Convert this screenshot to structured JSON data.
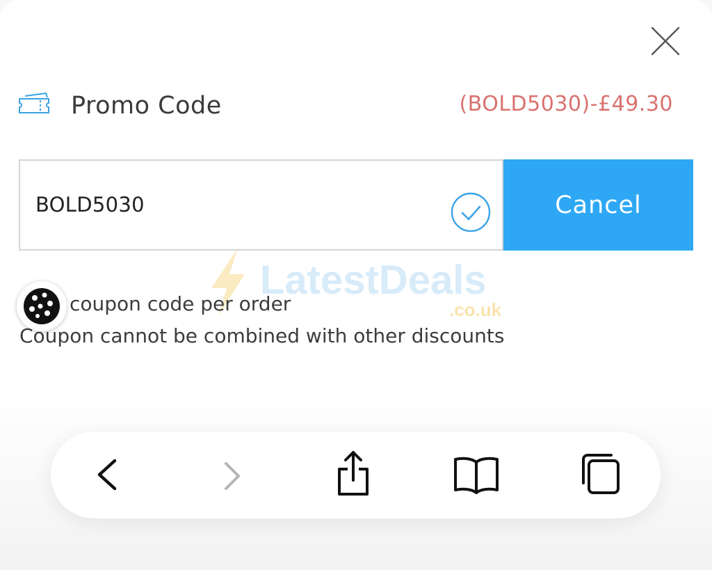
{
  "promo": {
    "title": "Promo Code",
    "applied_summary": "(BOLD5030)-£49.30",
    "code_value": "BOLD5030",
    "cancel_label": "Cancel"
  },
  "rules": {
    "line1": "coupon code per order",
    "line2": "Coupon cannot be combined with other discounts"
  },
  "watermark": {
    "brand": "LatestDeals",
    "domain": ".co.uk"
  },
  "icons": {
    "close": "close-icon",
    "ticket": "ticket-icon",
    "check": "check-circle-icon",
    "cookie": "cookie-icon",
    "back": "chevron-left-icon",
    "forward": "chevron-right-icon",
    "share": "share-icon",
    "bookmarks": "book-icon",
    "tabs": "tabs-icon"
  },
  "colors": {
    "accent": "#2ea8f5",
    "discount_text": "#d9726f",
    "input_border": "#d4d4d4"
  }
}
